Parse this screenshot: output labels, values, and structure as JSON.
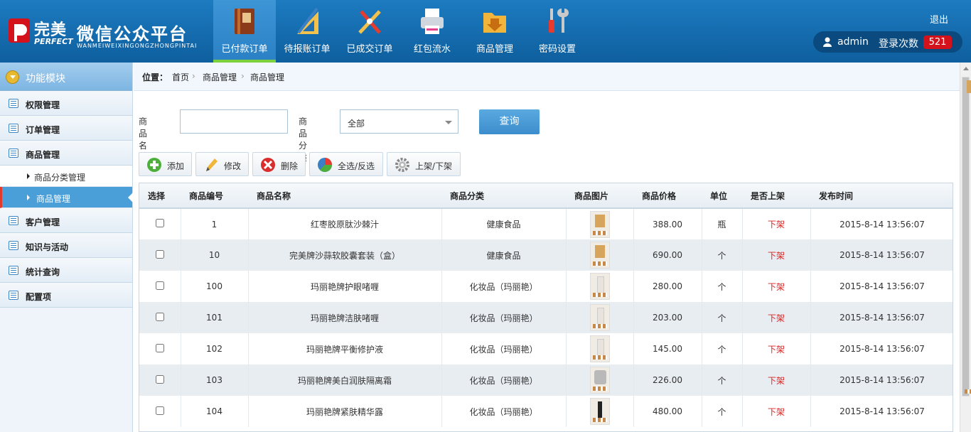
{
  "logo": {
    "brand": "完美",
    "brand_en": "PERFECT",
    "title": "微信公众平台",
    "subtitle": "WANMEIWEIXINGONGZHONGPINTAI"
  },
  "nav": [
    {
      "label": "已付款订单",
      "icon": "book-icon",
      "active": true
    },
    {
      "label": "待报账订单",
      "icon": "ruler-icon"
    },
    {
      "label": "已成交订单",
      "icon": "tools-icon"
    },
    {
      "label": "红包流水",
      "icon": "printer-icon"
    },
    {
      "label": "商品管理",
      "icon": "folder-icon"
    },
    {
      "label": "密码设置",
      "icon": "wrench-icon"
    }
  ],
  "header": {
    "logout": "退出",
    "username": "admin",
    "login_count_label": "登录次数",
    "login_count": "521"
  },
  "sidebar": {
    "title": "功能模块",
    "items": [
      {
        "label": "权限管理"
      },
      {
        "label": "订单管理"
      },
      {
        "label": "商品管理"
      },
      {
        "label": "客户管理"
      },
      {
        "label": "知识与活动"
      },
      {
        "label": "统计查询"
      },
      {
        "label": "配置项"
      }
    ],
    "subitems": [
      {
        "label": "商品分类管理"
      },
      {
        "label": "商品管理",
        "active": true
      }
    ]
  },
  "breadcrumb": {
    "label": "位置：",
    "items": [
      "首页",
      "商品管理",
      "商品管理"
    ]
  },
  "search": {
    "name_label": "商品名称",
    "name_value": "",
    "category_label": "商品分类",
    "category_value": "全部",
    "query_button": "查询"
  },
  "toolbar": {
    "add": "添加",
    "edit": "修改",
    "delete": "删除",
    "select_all": "全选/反选",
    "shelf": "上架/下架"
  },
  "table": {
    "headers": [
      "选择",
      "商品编号",
      "商品名称",
      "商品分类",
      "商品图片",
      "商品价格",
      "单位",
      "是否上架",
      "发布时间"
    ],
    "rows": [
      {
        "id": "1",
        "name": "红枣胶原肽沙棘汁",
        "category": "健康食品",
        "price": "388.00",
        "unit": "瓶",
        "status": "下架",
        "time": "2015-8-14 13:56:07"
      },
      {
        "id": "10",
        "name": "完美牌沙蒜软胶囊套装（盒）",
        "category": "健康食品",
        "price": "690.00",
        "unit": "个",
        "status": "下架",
        "time": "2015-8-14 13:56:07"
      },
      {
        "id": "100",
        "name": "玛丽艳牌护眼啫喱",
        "category": "化妆品（玛丽艳）",
        "price": "280.00",
        "unit": "个",
        "status": "下架",
        "time": "2015-8-14 13:56:07"
      },
      {
        "id": "101",
        "name": "玛丽艳牌洁肤啫喱",
        "category": "化妆品（玛丽艳）",
        "price": "203.00",
        "unit": "个",
        "status": "下架",
        "time": "2015-8-14 13:56:07"
      },
      {
        "id": "102",
        "name": "玛丽艳牌平衡修护液",
        "category": "化妆品（玛丽艳）",
        "price": "145.00",
        "unit": "个",
        "status": "下架",
        "time": "2015-8-14 13:56:07"
      },
      {
        "id": "103",
        "name": "玛丽艳牌美白润肤隔离霜",
        "category": "化妆品（玛丽艳）",
        "price": "226.00",
        "unit": "个",
        "status": "下架",
        "time": "2015-8-14 13:56:07"
      },
      {
        "id": "104",
        "name": "玛丽艳牌紧肤精华露",
        "category": "化妆品（玛丽艳）",
        "price": "480.00",
        "unit": "个",
        "status": "下架",
        "time": "2015-8-14 13:56:07"
      }
    ]
  }
}
